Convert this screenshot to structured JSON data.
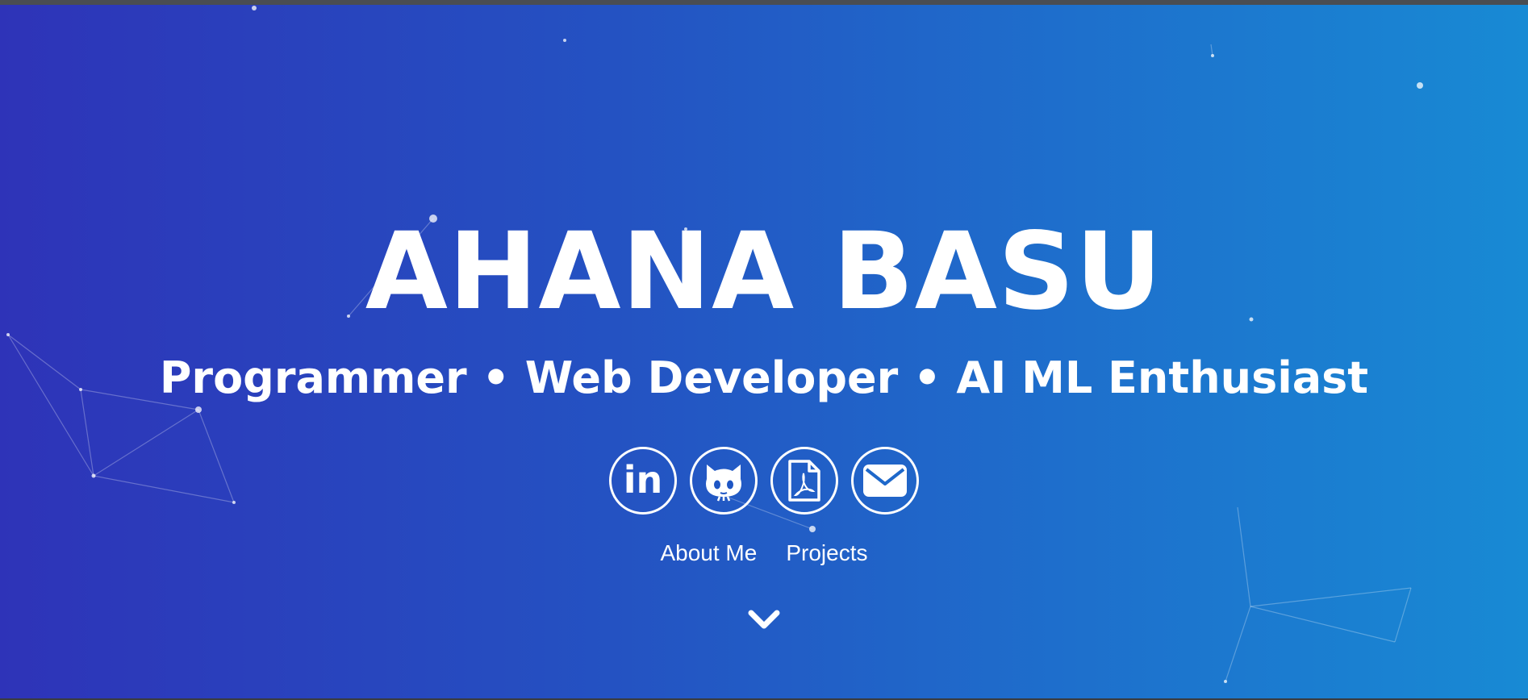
{
  "hero": {
    "name": "AHANA BASU",
    "tagline": "Programmer • Web Developer • AI ML Enthusiast"
  },
  "socials": [
    {
      "icon": "linkedin-icon",
      "label": "in"
    },
    {
      "icon": "github-icon"
    },
    {
      "icon": "resume-pdf-icon"
    },
    {
      "icon": "email-icon"
    }
  ],
  "links": {
    "about": "About Me",
    "projects": "Projects"
  },
  "colors": {
    "gradient_start": "#2e33b8",
    "gradient_end": "#188ad4",
    "text": "#ffffff"
  }
}
